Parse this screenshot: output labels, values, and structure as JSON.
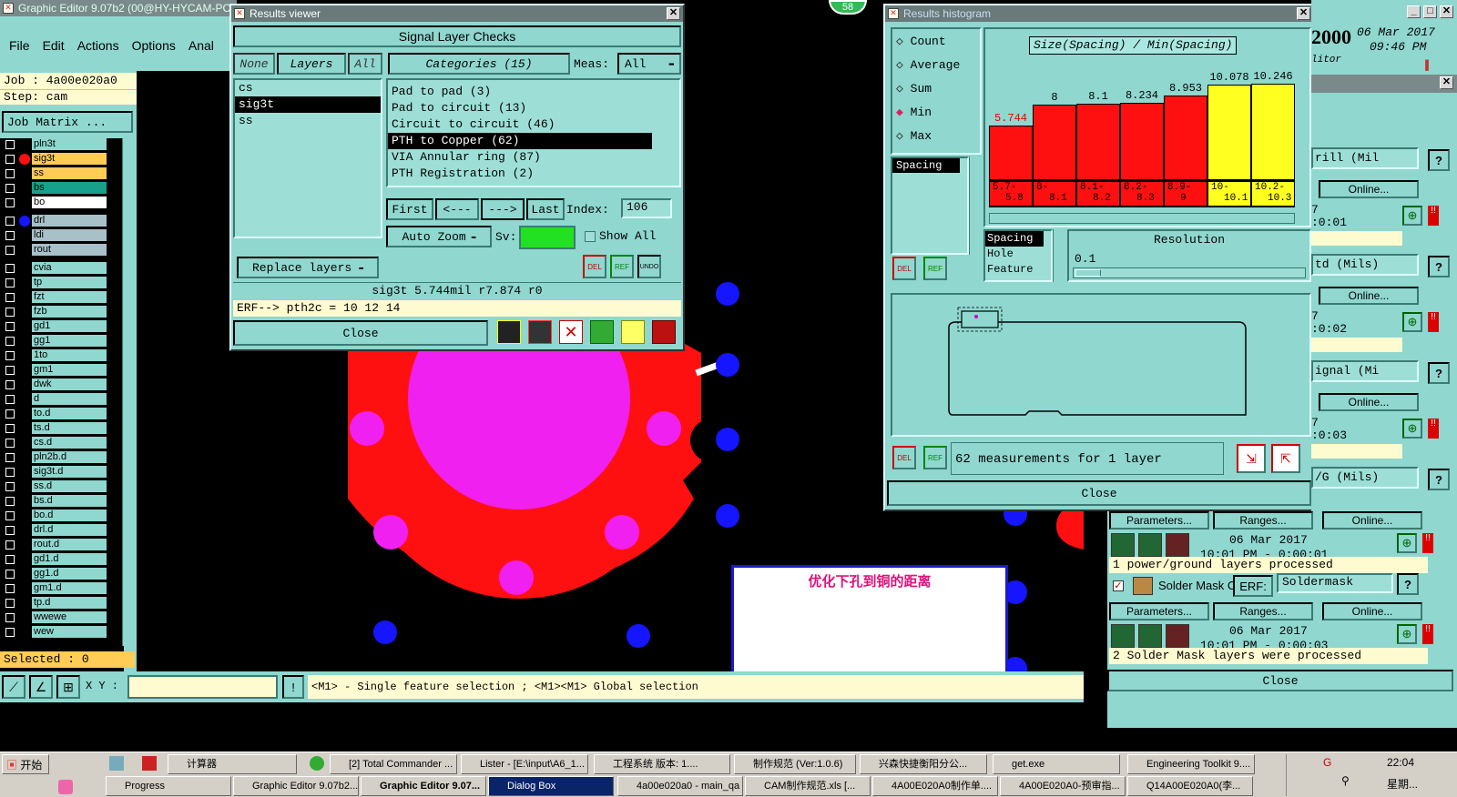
{
  "desktop": {
    "badge": "58"
  },
  "main": {
    "title": "Graphic Editor 9.07b2 (00@HY-HYCAM-PC",
    "menu": [
      "File",
      "Edit",
      "Actions",
      "Options",
      "Anal"
    ],
    "job": "Job : 4a00e020a0",
    "step": "Step: cam",
    "job_matrix": "Job Matrix ...",
    "layers": [
      "pln3t",
      "sig3t",
      "ss",
      "bs",
      "bo",
      "drl",
      "ldi",
      "rout",
      "cvia",
      "tp",
      "fzt",
      "fzb",
      "gd1",
      "gg1",
      "1to",
      "gm1",
      "dwk",
      "d",
      "to.d",
      "ts.d",
      "cs.d",
      "pln2b.d",
      "sig3t.d",
      "ss.d",
      "bs.d",
      "bo.d",
      "drl.d",
      "rout.d",
      "gd1.d",
      "gg1.d",
      "gm1.d",
      "tp.d",
      "wwewe",
      "wew"
    ],
    "selected": "Selected : 0",
    "xy_label": "X Y :",
    "status": "<M1> - Single feature selection ; <M1><M1> Global selection",
    "annotation": "优化下孔到铜的距离"
  },
  "results_viewer": {
    "title": "Results viewer",
    "header": "Signal Layer Checks",
    "btn_none": "None",
    "btn_layers": "Layers",
    "btn_all": "All",
    "categories_label": "Categories (15)",
    "meas_label": "Meas:",
    "meas_value": "All",
    "layers": [
      "cs",
      "sig3t",
      "ss"
    ],
    "categories": [
      "Pad to pad (3)",
      "Pad to circuit (13)",
      "Circuit to circuit (46)",
      "PTH to Copper (62)",
      "VIA Annular ring (87)",
      "PTH Registration (2)"
    ],
    "btn_first": "First",
    "btn_prev": "<---",
    "btn_next": "--->",
    "btn_last": "Last",
    "index_label": "Index:",
    "index_value": "106",
    "btn_autozoom": "Auto Zoom",
    "sv_label": "Sv:",
    "show_all": "Show All",
    "btn_replace": "Replace layers",
    "icon_del": "DEL",
    "icon_ref": "REF",
    "icon_undo": "UNDO",
    "info": "sig3t 5.744mil   r7.874  r0",
    "erf": "ERF--> pth2c = 10 12 14",
    "btn_close": "Close"
  },
  "histogram": {
    "title": "Results histogram",
    "modes": [
      "Count",
      "Average",
      "Sum",
      "Min",
      "Max"
    ],
    "chart_title": "Size(Spacing) / Min(Spacing)",
    "list_items": [
      "Spacing"
    ],
    "sort_items": [
      "Spacing",
      "Hole",
      "Feature"
    ],
    "resolution_label": "Resolution",
    "resolution_value": "0.1",
    "icon_del": "DEL",
    "icon_ref": "REF",
    "summary": "62 measurements for 1 layer",
    "btn_close": "Close"
  },
  "chart_data": {
    "type": "bar",
    "title": "Size(Spacing) / Min(Spacing)",
    "categories": [
      "5.7-5.8",
      "8-8.1",
      "8.1-8.2",
      "8.2-8.3",
      "8.9-9",
      "10-10.1",
      "10.2-10.3"
    ],
    "values": [
      5.744,
      8,
      8.1,
      8.234,
      8.953,
      10.078,
      10.246
    ],
    "value_labels": [
      "5.744",
      "8",
      "8.1",
      "8.234",
      "8.953",
      "10.078",
      "10.246"
    ],
    "category_labels": [
      [
        "5.7-",
        "5.8"
      ],
      [
        "8-",
        "8.1"
      ],
      [
        "8.1-",
        "8.2"
      ],
      [
        "8.2-",
        "8.3"
      ],
      [
        "8.9-",
        "9"
      ],
      [
        "10-",
        "10.1"
      ],
      [
        "10.2-",
        "10.3"
      ]
    ],
    "colors": [
      "#ff1010",
      "#ff1010",
      "#ff1010",
      "#ff1010",
      "#ff1010",
      "#ffff20",
      "#ffff20"
    ],
    "ylim": [
      0,
      10.8
    ]
  },
  "toolkit": {
    "clock_year": "2000",
    "clock_date": "06 Mar 2017",
    "clock_time": "09:46 PM",
    "clock_sub": "litor",
    "row_labels": [
      "rill (Mil",
      "td (Mils)",
      "ignal (Mi",
      "/G (Mils)"
    ],
    "online": "Online...",
    "times": [
      "7",
      ":0:01",
      "7",
      ":0:02",
      "7",
      ":0:03"
    ],
    "params": "Parameters...",
    "ranges": "Ranges...",
    "date1": "06 Mar 2017",
    "time1": "10:01 PM - 0:00:01",
    "msg1": "1 power/ground layers processed",
    "solder": "Solder Mask Ch",
    "erf": "ERF:",
    "soldermask": "Soldermask",
    "date2": "06 Mar 2017",
    "time2": "10:01 PM - 0:00:03",
    "msg2": "2 Solder Mask layers were processed",
    "btn_close": "Close"
  },
  "taskbar": {
    "start": "开始",
    "row1": [
      "计算器",
      "[2] Total Commander ...",
      "Lister - [E:\\input\\A6_1...",
      "工程系统  版本: 1....",
      "制作规范 (Ver:1.0.6)",
      "兴森快捷衡阳分公...",
      "get.exe",
      "Engineering Toolkit 9...."
    ],
    "row2": [
      "Progress",
      "Graphic Editor 9.07b2...",
      "Graphic Editor 9.07...",
      "Dialog Box",
      "4a00e020a0 - main_qa",
      "CAM制作规范.xls  [...",
      "4A00E020A0制作单....",
      "4A00E020A0-预审指...",
      "Q14A00E020A0(李..."
    ],
    "clock": "22:04",
    "day": "星期..."
  }
}
